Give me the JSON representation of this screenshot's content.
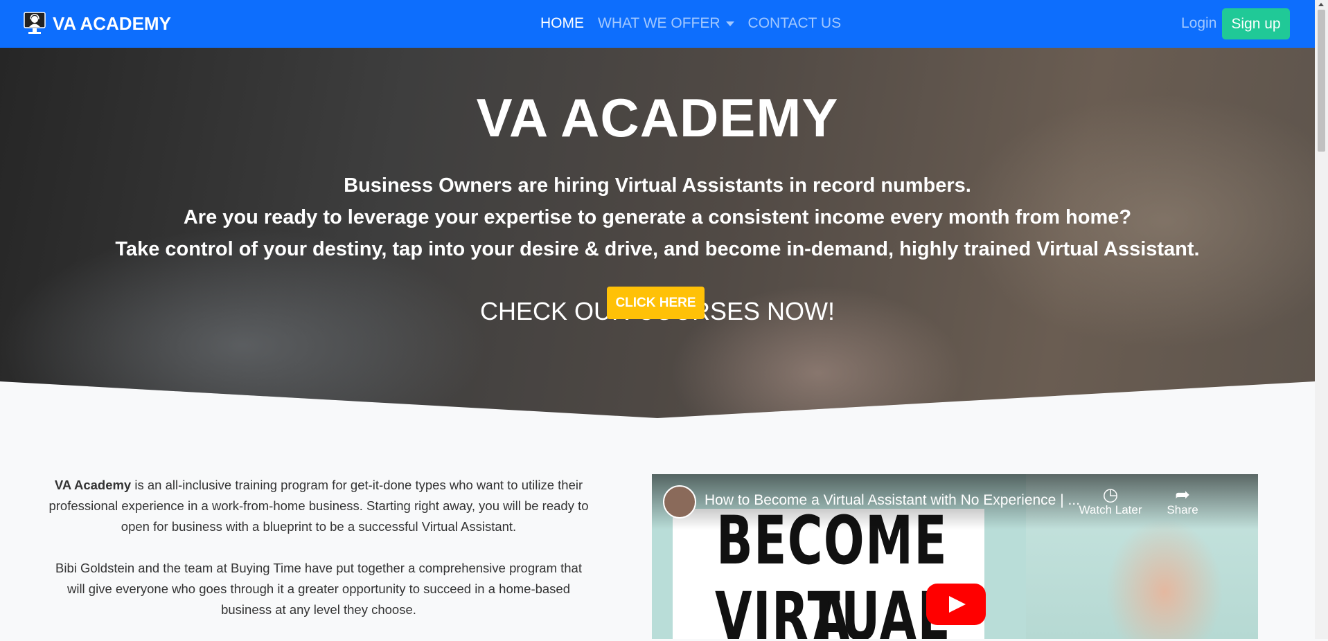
{
  "navbar": {
    "brand": "VA ACADEMY",
    "brand_icon": "computer-support-icon",
    "links": [
      {
        "label": "HOME",
        "active": true
      },
      {
        "label": "WHAT WE OFFER",
        "dropdown": true
      },
      {
        "label": "CONTACT US"
      }
    ],
    "login_label": "Login",
    "signup_label": "Sign up",
    "colors": {
      "background": "#0d6efd",
      "signup": "#20c997"
    }
  },
  "hero": {
    "title": "VA ACADEMY",
    "lines": [
      "Business Owners are hiring Virtual Assistants in record numbers.",
      "Are you ready to leverage your expertise to generate a consistent income every month from home?",
      "Take control of your destiny, tap into your desire & drive, and become in-demand, highly trained Virtual Assistant."
    ],
    "cta_heading": "CHECK OUR COURSES NOW!",
    "cta_button": "CLICK HERE",
    "cta_color": "#ffc107"
  },
  "intro": {
    "p1_bold": "VA Academy",
    "p1_rest": " is an all-inclusive training program for get-it-done types who want to utilize their professional experience in a work-from-home business. Starting right away, you will be ready to open for business with a blueprint to be a successful Virtual Assistant.",
    "p2": "Bibi Goldstein and the team at Buying Time have put together a comprehensive program that will give everyone who goes through it a greater opportunity to succeed in a home-based business at any level they choose."
  },
  "video": {
    "title": "How to Become a Virtual Assistant with No Experience | ...",
    "watch_later": "Watch Later",
    "share": "Share",
    "thumb_line1": "BECOME A",
    "thumb_line2": "VIRTUAL",
    "play_color": "#ff0000"
  }
}
